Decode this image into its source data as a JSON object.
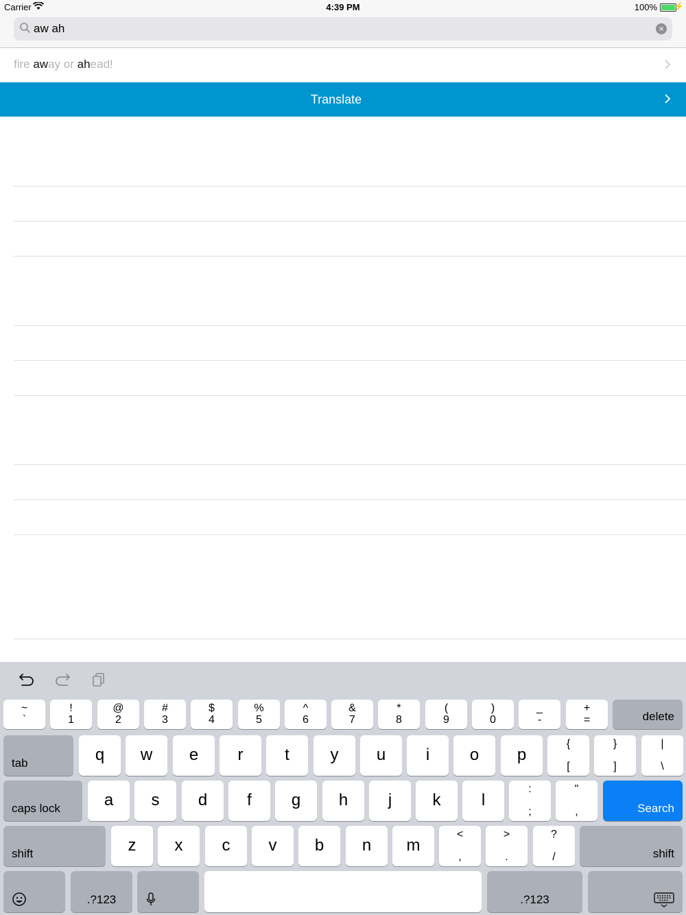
{
  "status": {
    "carrier": "Carrier",
    "time": "4:39 PM",
    "battery": "100%"
  },
  "search": {
    "value": "aw ah",
    "placeholder": ""
  },
  "suggestion": {
    "p1": "fire ",
    "m1": "aw",
    "p2": "ay or ",
    "m2": "ah",
    "p3": "ead!"
  },
  "translate_label": "Translate",
  "colors": {
    "accent": "#0095cf",
    "search_key": "#0a7ff6",
    "keyboard_bg": "#d1d4da"
  },
  "keyboard": {
    "row1": [
      {
        "top": "~",
        "bot": "`"
      },
      {
        "top": "!",
        "bot": "1"
      },
      {
        "top": "@",
        "bot": "2"
      },
      {
        "top": "#",
        "bot": "3"
      },
      {
        "top": "$",
        "bot": "4"
      },
      {
        "top": "%",
        "bot": "5"
      },
      {
        "top": "^",
        "bot": "6"
      },
      {
        "top": "&",
        "bot": "7"
      },
      {
        "top": "*",
        "bot": "8"
      },
      {
        "top": "(",
        "bot": "9"
      },
      {
        "top": ")",
        "bot": "0"
      },
      {
        "top": "_",
        "bot": "-"
      },
      {
        "top": "+",
        "bot": "="
      }
    ],
    "delete": "delete",
    "tab": "tab",
    "row2": [
      "q",
      "w",
      "e",
      "r",
      "t",
      "y",
      "u",
      "i",
      "o",
      "p"
    ],
    "row2_sym": [
      {
        "top": "{",
        "bot": "["
      },
      {
        "top": "}",
        "bot": "]"
      },
      {
        "top": "|",
        "bot": "\\"
      }
    ],
    "caps": "caps lock",
    "row3": [
      "a",
      "s",
      "d",
      "f",
      "g",
      "h",
      "j",
      "k",
      "l"
    ],
    "row3_sym": [
      {
        "top": ":",
        "bot": ";"
      },
      {
        "top": "\"",
        "bot": ","
      }
    ],
    "search": "Search",
    "shift": "shift",
    "row4": [
      "z",
      "x",
      "c",
      "v",
      "b",
      "n",
      "m"
    ],
    "row4_sym": [
      {
        "top": "<",
        "bot": ","
      },
      {
        "top": ">",
        "bot": "."
      },
      {
        "top": "?",
        "bot": "/"
      }
    ],
    "num": ".?123"
  }
}
